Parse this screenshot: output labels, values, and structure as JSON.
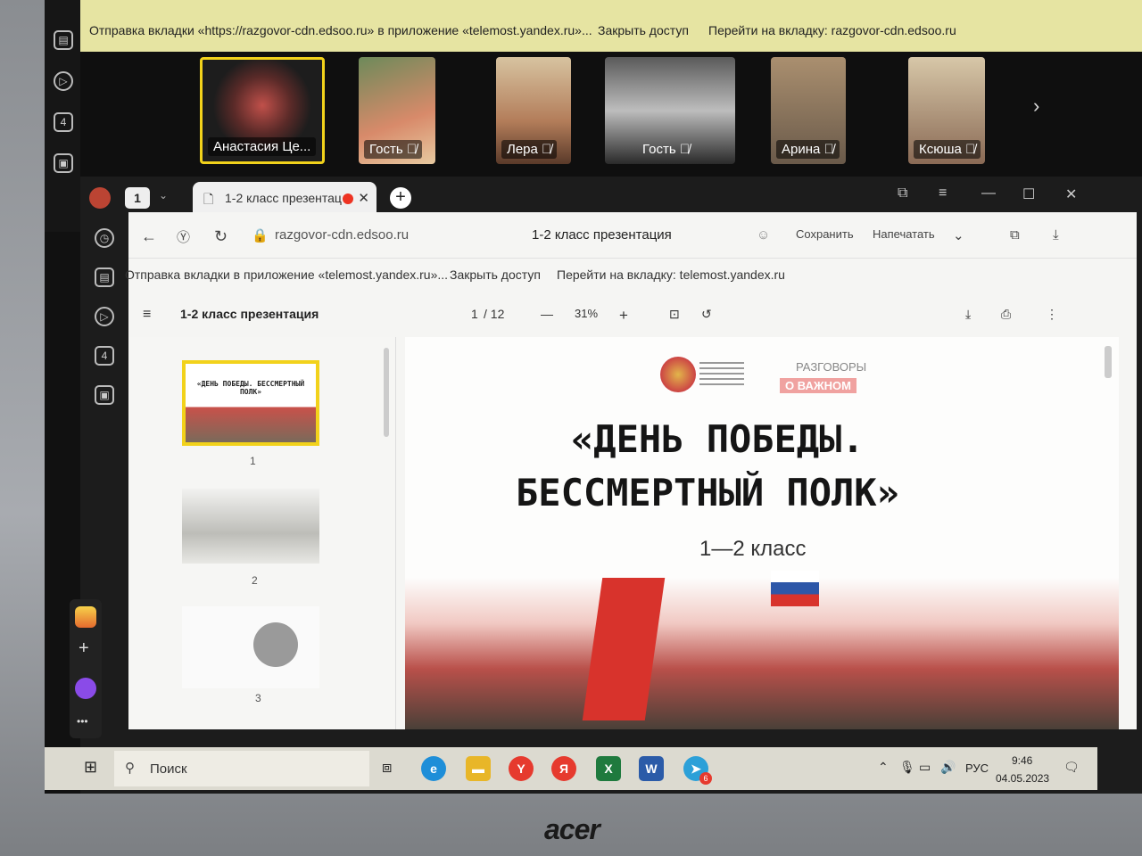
{
  "notification_bar": {
    "text": "Отправка вкладки «https://razgovor-cdn.edsoo.ru» в приложение «telemost.yandex.ru»...",
    "close_access": "Закрыть доступ",
    "goto_tab": "Перейти на вкладку: razgovor-cdn.edsoo.ru"
  },
  "participants": [
    {
      "name": "Анастасия Це...",
      "active": true
    },
    {
      "name": "Гость",
      "muted": true
    },
    {
      "name": "Лера",
      "muted": true
    },
    {
      "name": "Гость",
      "muted": true
    },
    {
      "name": "Арина",
      "muted": true
    },
    {
      "name": "Ксюша",
      "muted": true
    }
  ],
  "side_badge": "4",
  "browser": {
    "tab_count": "1",
    "tab_title": "1-2 класс презентац",
    "url": "razgovor-cdn.edsoo.ru",
    "page_title": "1-2 класс презентация",
    "save_label": "Сохранить",
    "print_label": "Напечатать",
    "infobar": {
      "text": "Отправка вкладки в приложение «telemost.yandex.ru»...",
      "close_access": "Закрыть доступ",
      "goto_tab": "Перейти на вкладку: telemost.yandex.ru"
    }
  },
  "pdf": {
    "doc_title": "1-2 класс презентация",
    "page_current": "1",
    "page_total": "/ 12",
    "zoom": "31%",
    "thumbnails": [
      "1",
      "2",
      "3"
    ]
  },
  "slide": {
    "title_line1": "«ДЕНЬ ПОБЕДЫ.",
    "title_line2": "БЕССМЕРТНЫЙ ПОЛК»",
    "subtitle": "1—2 класс",
    "logo_text_1": "РАЗГОВОРЫ",
    "logo_text_2": "О ВАЖНОМ",
    "thumb1_text": "«ДЕНЬ ПОБЕДЫ. БЕССМЕРТНЫЙ ПОЛК»"
  },
  "taskbar": {
    "search_placeholder": "Поиск",
    "lang": "РУС",
    "time": "9:46",
    "date": "04.05.2023",
    "telegram_badge": "6"
  },
  "brand": "acer",
  "colors": {
    "accent_yellow": "#f2d21b",
    "notif_bg": "#e6e4a2",
    "yandex_red": "#e63a2e"
  }
}
